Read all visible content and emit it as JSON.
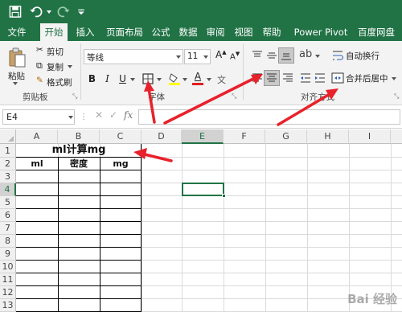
{
  "ribbon_tabs": [
    "文件",
    "开始",
    "插入",
    "页面布局",
    "公式",
    "数据",
    "审阅",
    "视图",
    "帮助",
    "Power Pivot",
    "百度网盘"
  ],
  "clipboard": {
    "paste": "粘贴",
    "cut": "剪切",
    "copy": "复制",
    "format_painter": "格式刷",
    "group": "剪贴板"
  },
  "font": {
    "name": "等线",
    "size": "11",
    "bold": "B",
    "italic": "I",
    "underline": "U",
    "group": "字体",
    "font_color_glyph": "A"
  },
  "alignment": {
    "wrap": "自动换行",
    "merge_center": "合并后居中",
    "group": "对齐方式"
  },
  "formula_bar": {
    "name_box": "E4",
    "fx": "fx",
    "cancel": "✕",
    "enter": "✓",
    "formula": ""
  },
  "columns": [
    "A",
    "B",
    "C",
    "D",
    "E",
    "F",
    "G",
    "H",
    "I"
  ],
  "rows": [
    "1",
    "2",
    "3",
    "4",
    "5",
    "6",
    "7",
    "8",
    "9",
    "10",
    "11",
    "12",
    "13",
    "14"
  ],
  "cells": {
    "a1_merged": "ml计算mg",
    "a2": "ml",
    "b2": "密度",
    "c2": "mg"
  },
  "active_cell": "E4",
  "watermark": "Bai 经验",
  "colors": {
    "excel_green": "#217346",
    "arrow_red": "#e8212b",
    "ribbon_bg": "#f3f3f3"
  }
}
